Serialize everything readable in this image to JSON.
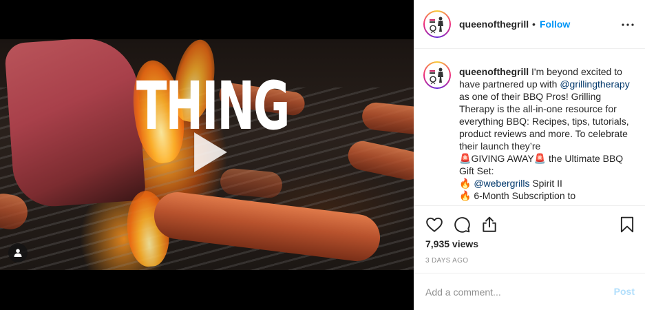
{
  "media": {
    "overlay_text": "THING",
    "play_icon": "play-icon",
    "user_tag_icon": "user-icon"
  },
  "post": {
    "username": "queenofthegrill",
    "separator": "•",
    "follow_label": "Follow",
    "more_icon": "more-options-icon",
    "avatar_icon": "profile-logo",
    "colors": {
      "follow": "#0095f6",
      "mention": "#00376b",
      "post_disabled": "#b2dffc",
      "muted": "#8e8e8e"
    }
  },
  "caption": {
    "username": "queenofthegrill",
    "intro": "I'm beyond excited to have partnered up with",
    "mention1": "@grillingtherapy",
    "body1": "as one of their BBQ Pros! Grilling Therapy is the all-in-one resource for everything BBQ: Recipes, tips, tutorials, product reviews and more. To celebrate their launch they’re",
    "siren1": "🚨",
    "giving_away": "GIVING AWAY",
    "siren2": "🚨",
    "body2": " the Ultimate BBQ Gift Set:",
    "fire1": "🔥",
    "mention2": "@webergrills",
    "item1_rest": " Spirit II",
    "fire2": "🔥",
    "item2": " 6-Month Subscription to"
  },
  "actions": {
    "like_icon": "heart-icon",
    "comment_icon": "comment-icon",
    "share_icon": "share-icon",
    "save_icon": "bookmark-icon",
    "views": "7,935 views",
    "age": "3 DAYS AGO"
  },
  "comment": {
    "placeholder": "Add a comment...",
    "post_label": "Post"
  }
}
